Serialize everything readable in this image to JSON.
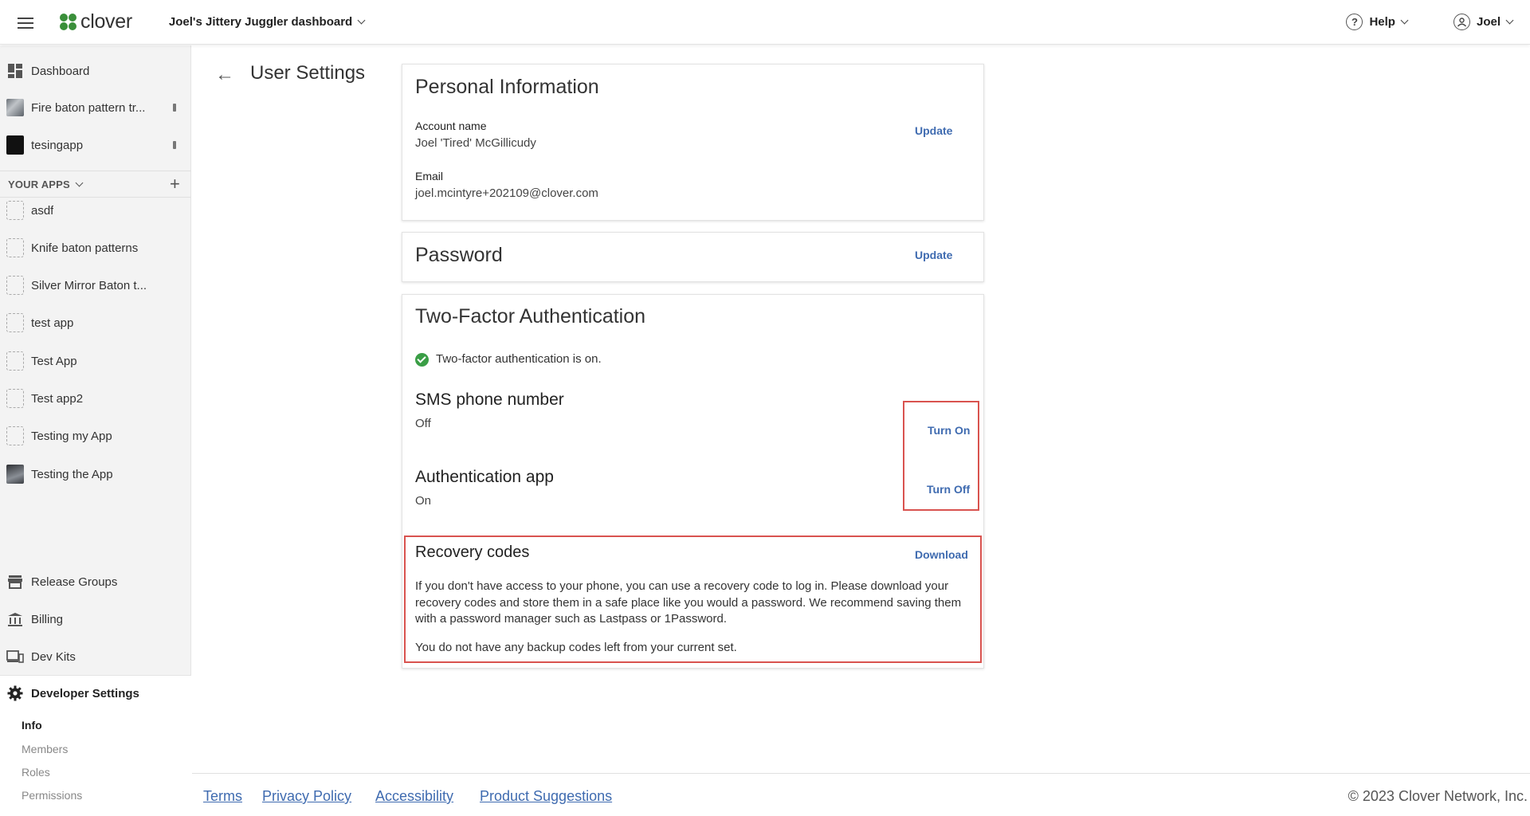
{
  "header": {
    "logo_text": "clover",
    "dashboard_name": "Joel's Jittery Juggler dashboard",
    "help_label": "Help",
    "help_icon_glyph": "?",
    "user_label": "Joel"
  },
  "sidebar": {
    "dashboard_label": "Dashboard",
    "pinned": [
      {
        "label": "Fire baton pattern tr..."
      },
      {
        "label": "tesingapp"
      }
    ],
    "your_apps_label": "YOUR APPS",
    "add_glyph": "+",
    "apps": [
      {
        "label": "asdf"
      },
      {
        "label": "Knife baton patterns"
      },
      {
        "label": "Silver Mirror Baton t..."
      },
      {
        "label": "test app"
      },
      {
        "label": "Test App"
      },
      {
        "label": "Test app2"
      },
      {
        "label": "Testing my App"
      },
      {
        "label": "Testing the App"
      }
    ],
    "bottom_items": [
      {
        "label": "Release Groups",
        "icon": "store-icon"
      },
      {
        "label": "Billing",
        "icon": "bank-icon"
      },
      {
        "label": "Dev Kits",
        "icon": "devices-icon"
      }
    ],
    "developer_settings": {
      "label": "Developer Settings",
      "items": [
        {
          "label": "Info"
        },
        {
          "label": "Members"
        },
        {
          "label": "Roles"
        },
        {
          "label": "Permissions"
        }
      ]
    }
  },
  "page": {
    "back_glyph": "←",
    "title": "User Settings"
  },
  "personal_info": {
    "title": "Personal Information",
    "account_name_label": "Account name",
    "account_name_value": "Joel 'Tired' McGillicudy",
    "email_label": "Email",
    "email_value": "joel.mcintyre+202109@clover.com",
    "update_label": "Update"
  },
  "password": {
    "title": "Password",
    "update_label": "Update"
  },
  "two_factor": {
    "title": "Two-Factor Authentication",
    "status_text": "Two-factor authentication is on.",
    "sms_title": "SMS phone number",
    "sms_status": "Off",
    "sms_action": "Turn On",
    "app_title": "Authentication app",
    "app_status": "On",
    "app_action": "Turn Off",
    "recovery_title": "Recovery codes",
    "recovery_action": "Download",
    "recovery_paragraph": "If you don't have access to your phone, you can use a recovery code to log in. Please download your recovery codes and store them in a safe place like you would a password. We recommend saving them with a password manager such as Lastpass or 1Password.",
    "backup_status": "You do not have any backup codes left from your current set."
  },
  "footer": {
    "links": [
      "Terms",
      "Privacy Policy",
      "Accessibility",
      "Product Suggestions"
    ],
    "copyright": "© 2023 Clover Network, Inc."
  },
  "colors": {
    "link_blue": "#3f6bb0",
    "success_green": "#3a9e46",
    "highlight_red": "#d9534f",
    "brand_green": "#3a8f3a"
  }
}
